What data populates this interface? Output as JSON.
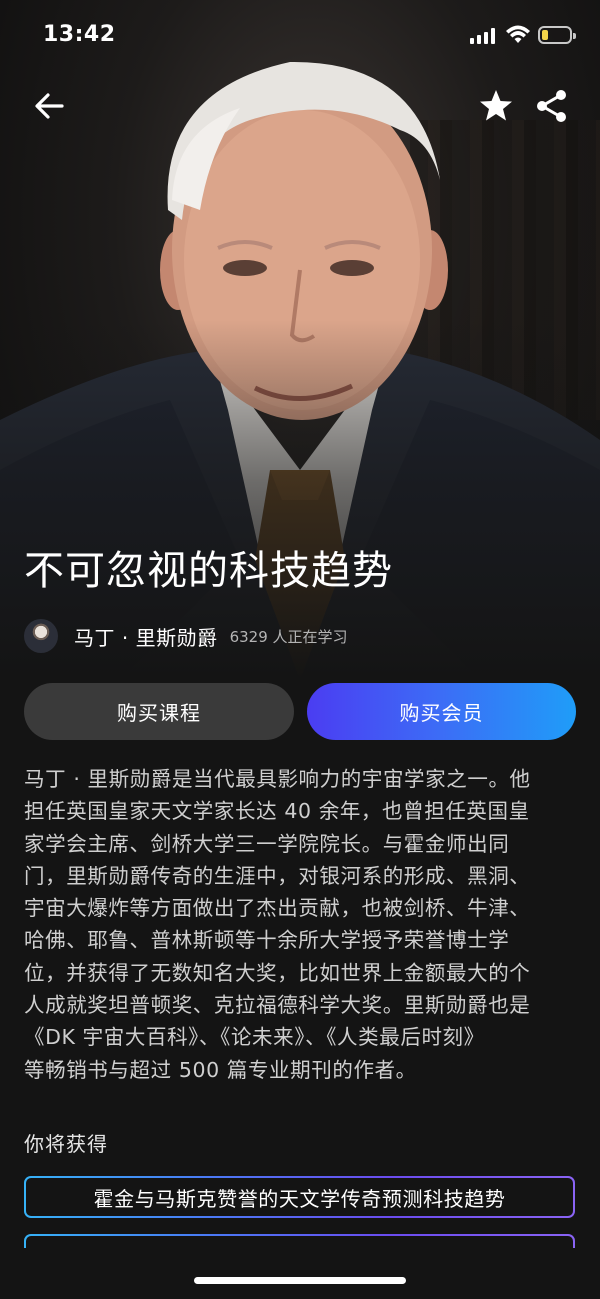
{
  "status": {
    "time": "13:42",
    "battery_color": "#f4d54a",
    "battery_level": 0.22
  },
  "nav": {
    "back_icon": "arrow-left-icon",
    "favorite_icon": "star-icon",
    "share_icon": "share-icon"
  },
  "course": {
    "title": "不可忽视的科技趋势",
    "author": "马丁 · 里斯勋爵",
    "learners": "6329 人正在学习"
  },
  "buttons": {
    "buy_course": "购买课程",
    "buy_membership": "购买会员",
    "membership_gradient": [
      "#4b3df2",
      "#1f9df8"
    ]
  },
  "description": {
    "lines": [
      "马丁 · 里斯勋爵是当代最具影响力的宇宙学家之一。他",
      "担任英国皇家天文学家长达 40 余年，也曾担任英国皇",
      "家学会主席、剑桥大学三一学院院长。与霍金师出同",
      "门，里斯勋爵传奇的生涯中，对银河系的形成、黑洞、",
      "宇宙大爆炸等方面做出了杰出贡献，也被剑桥、牛津、",
      "哈佛、耶鲁、普林斯顿等十余所大学授予荣誉博士学",
      "位，并获得了无数知名大奖，比如世界上金额最大的个",
      "人成就奖坦普顿奖、克拉福德科学大奖。里斯勋爵也是",
      "《DK 宇宙大百科》、《论未来》、《人类最后时刻》",
      "等畅销书与超过 500 篇专业期刊的作者。"
    ]
  },
  "gains": {
    "heading": "你将获得",
    "items": [
      "霍金与马斯克赞誉的天文学传奇预测科技趋势"
    ]
  }
}
